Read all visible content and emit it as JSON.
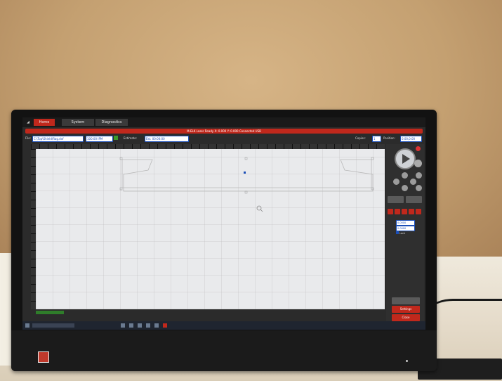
{
  "app": {
    "tabs": [
      {
        "label": "Home",
        "active": true
      },
      {
        "label": "System",
        "active": false
      },
      {
        "label": "Diagnostics",
        "active": false
      }
    ],
    "status_bar": "M-ELK  Laser Ready  X: 0.000  Y: 0.000  Connected  USB",
    "file_label": "File:",
    "file_name": "C:\\Top\\Shield\\Rag.dxf",
    "speed_value": "100.00 IPM",
    "estimated_label": "Estimate:",
    "estimated_value": "Est. 00:00:00",
    "copies_label": "Copies:",
    "copies_value": "1",
    "position_label": "Position:",
    "position_value": "0.00,0.00"
  },
  "controls": {
    "x_value": "0.0000",
    "y_value": "0.0000",
    "check_label": "Lock",
    "buttons": [
      "Settings",
      "Close"
    ]
  },
  "colors": {
    "accent": "#c0281c",
    "selection": "#1b4fb8",
    "canvas": "#e9eaec"
  },
  "icons": [
    "play-icon",
    "pause-icon",
    "stop-icon",
    "jog-pad-icon",
    "zoom-icon"
  ]
}
